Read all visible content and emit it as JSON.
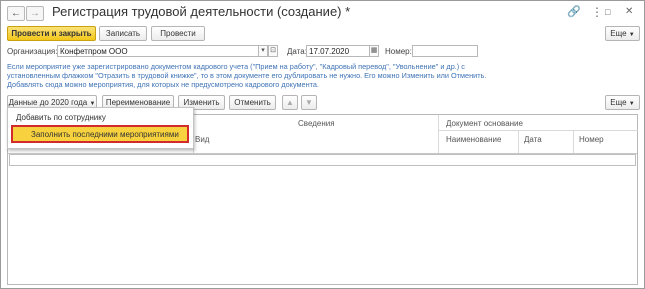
{
  "window": {
    "title": "Регистрация трудовой деятельности (создание) *",
    "back_icon": "arrow-left-icon",
    "forward_icon": "arrow-right-icon",
    "star_icon": "star-icon",
    "link_icon": "link-icon",
    "menu_icon": "more-icon",
    "close_icon": "close-icon"
  },
  "toolbar": {
    "post_close": "Провести и закрыть",
    "save": "Записать",
    "post": "Провести",
    "more": "Еще"
  },
  "form": {
    "org_label": "Организация:",
    "org_value": "Конфетпром ООО",
    "date_label": "Дата:",
    "date_value": "17.07.2020",
    "number_label": "Номер:",
    "number_value": ""
  },
  "info_text": "Если мероприятие уже зарегистрировано документом кадрового учета (\"Прием на работу\", \"Кадровый перевод\", \"Увольнение\" и др.) с установленным флажком \"Отразить в трудовой книжке\", то в этом документе его дублировать не нужно. Его можно Изменить или Отменить. Добавлять сюда можно мероприятия, для которых не предусмотрено кадрового документа.",
  "table_toolbar": {
    "data_before_2020": "Данные до 2020 года",
    "rename": "Переименование",
    "change": "Изменить",
    "cancel": "Отменить",
    "more": "Еще"
  },
  "dropdown": {
    "items": [
      "Добавить по сотруднику",
      "Заполнить последними мероприятиями"
    ]
  },
  "table": {
    "col_type": "Вид",
    "col_info": "Сведения",
    "col_basis": "Документ основание",
    "col_name": "Наименование",
    "col_date": "Дата",
    "col_number": "Номер"
  },
  "colors": {
    "primary": "#f3c71a",
    "highlight_border": "#d22b2b",
    "info_text": "#3f73b6"
  }
}
